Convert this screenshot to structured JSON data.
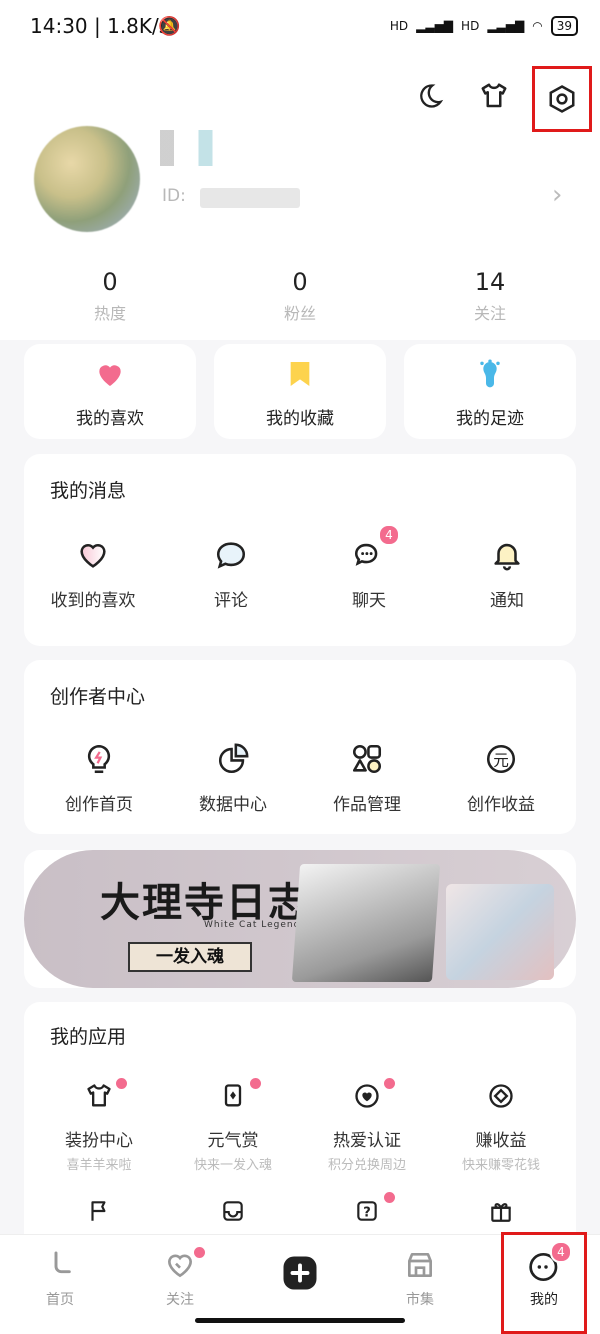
{
  "status_bar": {
    "time": "14:30 | 1.8K/s",
    "network1": "HD",
    "network2": "HD",
    "battery": "39"
  },
  "top_actions": {
    "night_mode": "moon-icon",
    "skin": "tshirt-icon",
    "settings": "settings-hexagon-icon"
  },
  "profile": {
    "id_label": "ID:"
  },
  "stats": [
    {
      "value": "0",
      "label": "热度"
    },
    {
      "value": "0",
      "label": "粉丝"
    },
    {
      "value": "14",
      "label": "关注"
    }
  ],
  "quick_links": [
    {
      "label": "我的喜欢",
      "icon": "heart-icon",
      "color": "#f36b8e"
    },
    {
      "label": "我的收藏",
      "icon": "bookmark-icon",
      "color": "#fdd34d"
    },
    {
      "label": "我的足迹",
      "icon": "footprint-icon",
      "color": "#4ab8e8"
    }
  ],
  "messages": {
    "title": "我的消息",
    "items": [
      {
        "label": "收到的喜欢",
        "icon": "heart-outline-icon"
      },
      {
        "label": "评论",
        "icon": "comment-icon"
      },
      {
        "label": "聊天",
        "icon": "chat-icon",
        "badge": "4"
      },
      {
        "label": "通知",
        "icon": "bell-icon"
      }
    ]
  },
  "creator": {
    "title": "创作者中心",
    "items": [
      {
        "label": "创作首页",
        "icon": "bulb-icon"
      },
      {
        "label": "数据中心",
        "icon": "pie-chart-icon"
      },
      {
        "label": "作品管理",
        "icon": "shapes-icon"
      },
      {
        "label": "创作收益",
        "icon": "yuan-coin-icon"
      }
    ]
  },
  "banner": {
    "title": "大理寺日志",
    "subtitle": "White Cat Legend",
    "button": "一发入魂"
  },
  "apps": {
    "title": "我的应用",
    "items": [
      {
        "label": "装扮中心",
        "sub": "喜羊羊来啦",
        "icon": "tshirt-icon"
      },
      {
        "label": "元气赏",
        "sub": "快来一发入魂",
        "icon": "cards-icon"
      },
      {
        "label": "热爱认证",
        "sub": "积分兑换周边",
        "icon": "heart-badge-icon"
      },
      {
        "label": "赚收益",
        "sub": "快来赚零花钱",
        "icon": "coin-icon"
      }
    ],
    "row2_icons": [
      "flag-icon",
      "inbox-icon",
      "help-icon",
      "gift-icon"
    ]
  },
  "tabbar": [
    {
      "label": "首页",
      "icon": "home-tab-icon"
    },
    {
      "label": "关注",
      "icon": "follow-tab-icon"
    },
    {
      "label": "",
      "icon": "plus-icon"
    },
    {
      "label": "市集",
      "icon": "market-icon"
    },
    {
      "label": "我的",
      "icon": "me-tab-icon",
      "badge": "4"
    }
  ],
  "colors": {
    "accent": "#f36b8e",
    "highlight": "#e01a1a"
  }
}
